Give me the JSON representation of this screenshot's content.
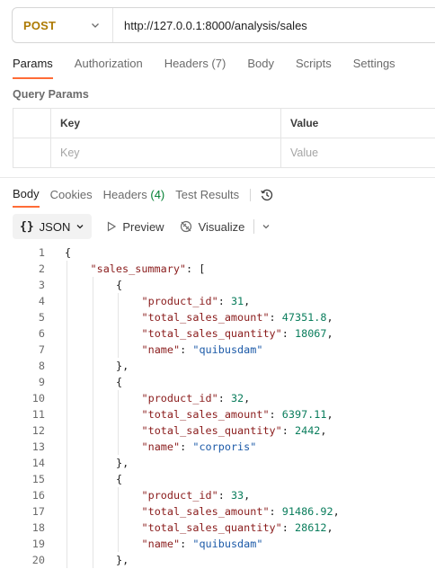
{
  "request": {
    "method": "POST",
    "url": "http://127.0.0.1:8000/analysis/sales"
  },
  "request_tabs": [
    {
      "label": "Params",
      "active": true
    },
    {
      "label": "Authorization",
      "active": false
    },
    {
      "label": "Headers (7)",
      "active": false
    },
    {
      "label": "Body",
      "active": false
    },
    {
      "label": "Scripts",
      "active": false
    },
    {
      "label": "Settings",
      "active": false
    }
  ],
  "query_params": {
    "title": "Query Params",
    "columns": [
      "Key",
      "Value"
    ],
    "placeholders": [
      "Key",
      "Value"
    ]
  },
  "response_tabs": {
    "body": "Body",
    "cookies": "Cookies",
    "headers": "Headers",
    "headers_count": "(4)",
    "test_results": "Test Results"
  },
  "response_toolbar": {
    "format": "JSON",
    "preview": "Preview",
    "visualize": "Visualize"
  },
  "colors": {
    "accent": "#ff6c37",
    "method": "#ad7a03",
    "json_key": "#8a1c1c",
    "json_string": "#1c5aa8",
    "json_number": "#0a7d5c"
  },
  "code_lines": [
    {
      "n": "1",
      "indent": 0,
      "parts": [
        {
          "t": "{",
          "c": "p"
        }
      ]
    },
    {
      "n": "2",
      "indent": 1,
      "parts": [
        {
          "t": "\"sales_summary\"",
          "c": "k"
        },
        {
          "t": ": [",
          "c": "p"
        }
      ]
    },
    {
      "n": "3",
      "indent": 2,
      "parts": [
        {
          "t": "{",
          "c": "p"
        }
      ]
    },
    {
      "n": "4",
      "indent": 3,
      "parts": [
        {
          "t": "\"product_id\"",
          "c": "k"
        },
        {
          "t": ": ",
          "c": "p"
        },
        {
          "t": "31",
          "c": "n"
        },
        {
          "t": ",",
          "c": "p"
        }
      ]
    },
    {
      "n": "5",
      "indent": 3,
      "parts": [
        {
          "t": "\"total_sales_amount\"",
          "c": "k"
        },
        {
          "t": ": ",
          "c": "p"
        },
        {
          "t": "47351.8",
          "c": "n"
        },
        {
          "t": ",",
          "c": "p"
        }
      ]
    },
    {
      "n": "6",
      "indent": 3,
      "parts": [
        {
          "t": "\"total_sales_quantity\"",
          "c": "k"
        },
        {
          "t": ": ",
          "c": "p"
        },
        {
          "t": "18067",
          "c": "n"
        },
        {
          "t": ",",
          "c": "p"
        }
      ]
    },
    {
      "n": "7",
      "indent": 3,
      "parts": [
        {
          "t": "\"name\"",
          "c": "k"
        },
        {
          "t": ": ",
          "c": "p"
        },
        {
          "t": "\"quibusdam\"",
          "c": "s"
        }
      ]
    },
    {
      "n": "8",
      "indent": 2,
      "parts": [
        {
          "t": "},",
          "c": "p"
        }
      ]
    },
    {
      "n": "9",
      "indent": 2,
      "parts": [
        {
          "t": "{",
          "c": "p"
        }
      ]
    },
    {
      "n": "10",
      "indent": 3,
      "parts": [
        {
          "t": "\"product_id\"",
          "c": "k"
        },
        {
          "t": ": ",
          "c": "p"
        },
        {
          "t": "32",
          "c": "n"
        },
        {
          "t": ",",
          "c": "p"
        }
      ]
    },
    {
      "n": "11",
      "indent": 3,
      "parts": [
        {
          "t": "\"total_sales_amount\"",
          "c": "k"
        },
        {
          "t": ": ",
          "c": "p"
        },
        {
          "t": "6397.11",
          "c": "n"
        },
        {
          "t": ",",
          "c": "p"
        }
      ]
    },
    {
      "n": "12",
      "indent": 3,
      "parts": [
        {
          "t": "\"total_sales_quantity\"",
          "c": "k"
        },
        {
          "t": ": ",
          "c": "p"
        },
        {
          "t": "2442",
          "c": "n"
        },
        {
          "t": ",",
          "c": "p"
        }
      ]
    },
    {
      "n": "13",
      "indent": 3,
      "parts": [
        {
          "t": "\"name\"",
          "c": "k"
        },
        {
          "t": ": ",
          "c": "p"
        },
        {
          "t": "\"corporis\"",
          "c": "s"
        }
      ]
    },
    {
      "n": "14",
      "indent": 2,
      "parts": [
        {
          "t": "},",
          "c": "p"
        }
      ]
    },
    {
      "n": "15",
      "indent": 2,
      "parts": [
        {
          "t": "{",
          "c": "p"
        }
      ]
    },
    {
      "n": "16",
      "indent": 3,
      "parts": [
        {
          "t": "\"product_id\"",
          "c": "k"
        },
        {
          "t": ": ",
          "c": "p"
        },
        {
          "t": "33",
          "c": "n"
        },
        {
          "t": ",",
          "c": "p"
        }
      ]
    },
    {
      "n": "17",
      "indent": 3,
      "parts": [
        {
          "t": "\"total_sales_amount\"",
          "c": "k"
        },
        {
          "t": ": ",
          "c": "p"
        },
        {
          "t": "91486.92",
          "c": "n"
        },
        {
          "t": ",",
          "c": "p"
        }
      ]
    },
    {
      "n": "18",
      "indent": 3,
      "parts": [
        {
          "t": "\"total_sales_quantity\"",
          "c": "k"
        },
        {
          "t": ": ",
          "c": "p"
        },
        {
          "t": "28612",
          "c": "n"
        },
        {
          "t": ",",
          "c": "p"
        }
      ]
    },
    {
      "n": "19",
      "indent": 3,
      "parts": [
        {
          "t": "\"name\"",
          "c": "k"
        },
        {
          "t": ": ",
          "c": "p"
        },
        {
          "t": "\"quibusdam\"",
          "c": "s"
        }
      ]
    },
    {
      "n": "20",
      "indent": 2,
      "parts": [
        {
          "t": "},",
          "c": "p"
        }
      ]
    }
  ]
}
